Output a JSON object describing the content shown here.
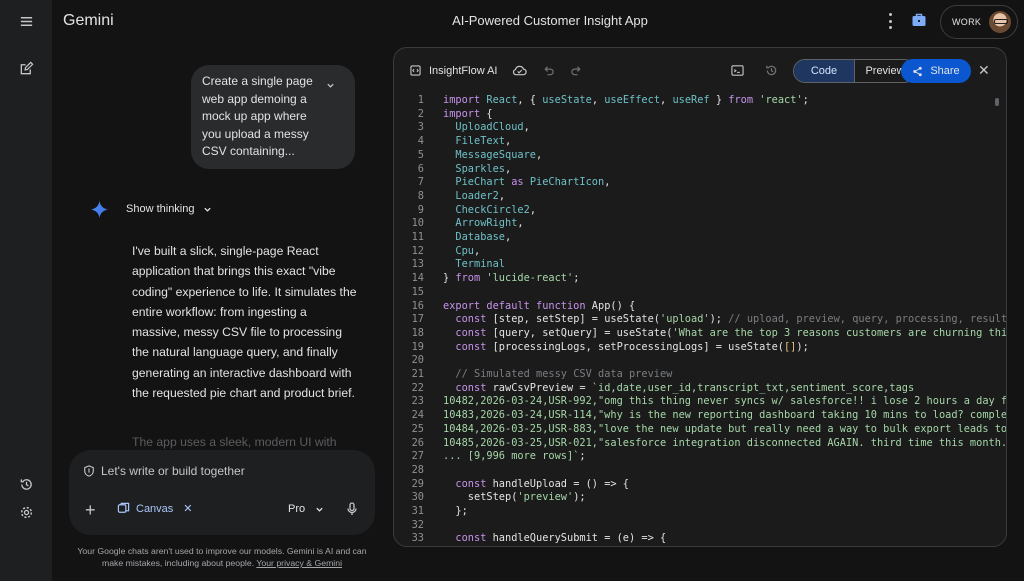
{
  "rail": {
    "items": [
      "menu",
      "new-chat",
      "history",
      "settings"
    ]
  },
  "brand": "Gemini",
  "app_title": "AI-Powered Customer Insight App",
  "account": {
    "label": "WORK"
  },
  "chat": {
    "user_prompt": "Create a single page web app demoing a mock up app where you upload a messy CSV containing...",
    "show_thinking": "Show thinking",
    "reply": "I've built a slick, single-page React application that brings this exact \"vibe coding\" experience to life. It simulates the entire workflow: from ingesting a massive, messy CSV file to processing the natural language query, and finally generating an interactive dashboard with the requested pie chart and product brief.",
    "reply_faded": "The app uses a sleek, modern UI with"
  },
  "composer": {
    "placeholder": "Let's write or build together",
    "canvas_label": "Canvas",
    "model": "Pro"
  },
  "disclaimer": {
    "text": "Your Google chats aren't used to improve our models. Gemini is AI and can make mistakes, including about people.",
    "link": "Your privacy & Gemini"
  },
  "editor": {
    "filename": "InsightFlow AI",
    "tab_code": "Code",
    "tab_preview": "Preview",
    "share": "Share",
    "active_tab": "Code"
  },
  "code_lines": [
    [
      [
        "k",
        "import "
      ],
      [
        "n",
        "React"
      ],
      [
        "f",
        ", { "
      ],
      [
        "n",
        "useState"
      ],
      [
        "f",
        ", "
      ],
      [
        "n",
        "useEffect"
      ],
      [
        "f",
        ", "
      ],
      [
        "n",
        "useRef"
      ],
      [
        "f",
        " } "
      ],
      [
        "k",
        "from "
      ],
      [
        "s",
        "'react'"
      ],
      [
        "f",
        ";"
      ]
    ],
    [
      [
        "k",
        "import "
      ],
      [
        "f",
        "{"
      ]
    ],
    [
      [
        "f",
        "  "
      ],
      [
        "n",
        "UploadCloud"
      ],
      [
        "f",
        ","
      ]
    ],
    [
      [
        "f",
        "  "
      ],
      [
        "n",
        "FileText"
      ],
      [
        "f",
        ","
      ]
    ],
    [
      [
        "f",
        "  "
      ],
      [
        "n",
        "MessageSquare"
      ],
      [
        "f",
        ","
      ]
    ],
    [
      [
        "f",
        "  "
      ],
      [
        "n",
        "Sparkles"
      ],
      [
        "f",
        ","
      ]
    ],
    [
      [
        "f",
        "  "
      ],
      [
        "n",
        "PieChart "
      ],
      [
        "k",
        "as "
      ],
      [
        "n",
        "PieChartIcon"
      ],
      [
        "f",
        ","
      ]
    ],
    [
      [
        "f",
        "  "
      ],
      [
        "n",
        "Loader2"
      ],
      [
        "f",
        ","
      ]
    ],
    [
      [
        "f",
        "  "
      ],
      [
        "n",
        "CheckCircle2"
      ],
      [
        "f",
        ","
      ]
    ],
    [
      [
        "f",
        "  "
      ],
      [
        "n",
        "ArrowRight"
      ],
      [
        "f",
        ","
      ]
    ],
    [
      [
        "f",
        "  "
      ],
      [
        "n",
        "Database"
      ],
      [
        "f",
        ","
      ]
    ],
    [
      [
        "f",
        "  "
      ],
      [
        "n",
        "Cpu"
      ],
      [
        "f",
        ","
      ]
    ],
    [
      [
        "f",
        "  "
      ],
      [
        "n",
        "Terminal"
      ]
    ],
    [
      [
        "f",
        "} "
      ],
      [
        "k",
        "from "
      ],
      [
        "s",
        "'lucide-react'"
      ],
      [
        "f",
        ";"
      ]
    ],
    [],
    [
      [
        "k",
        "export default function "
      ],
      [
        "f",
        "App() {"
      ]
    ],
    [
      [
        "f",
        "  "
      ],
      [
        "k",
        "const "
      ],
      [
        "f",
        "[step, setStep] = "
      ],
      [
        "f",
        "useState("
      ],
      [
        "s",
        "'upload'"
      ],
      [
        "f",
        "); "
      ],
      [
        "c",
        "// upload, preview, query, processing, results"
      ]
    ],
    [
      [
        "f",
        "  "
      ],
      [
        "k",
        "const "
      ],
      [
        "f",
        "[query, setQuery] = useState("
      ],
      [
        "s",
        "'What are the top 3 reasons customers are churning this"
      ]
    ],
    [
      [
        "f",
        "  "
      ],
      [
        "k",
        "const "
      ],
      [
        "f",
        "[processingLogs, setProcessingLogs] = useState("
      ],
      [
        "b",
        "[]"
      ],
      [
        "f",
        ");"
      ]
    ],
    [],
    [
      [
        "f",
        "  "
      ],
      [
        "c",
        "// Simulated messy CSV data preview"
      ]
    ],
    [
      [
        "f",
        "  "
      ],
      [
        "k",
        "const "
      ],
      [
        "f",
        "rawCsvPreview = "
      ],
      [
        "s",
        "`id,date,user_id,transcript_txt,sentiment_score,tags"
      ]
    ],
    [
      [
        "s",
        "10482,2026-03-24,USR-992,\"omg this thing never syncs w/ salesforce!! i lose 2 hours a day fi"
      ]
    ],
    [
      [
        "s",
        "10483,2026-03-24,USR-114,\"why is the new reporting dashboard taking 10 mins to load? complet"
      ]
    ],
    [
      [
        "s",
        "10484,2026-03-25,USR-883,\"love the new update but really need a way to bulk export leads to"
      ]
    ],
    [
      [
        "s",
        "10485,2026-03-25,USR-021,\"salesforce integration disconnected AGAIN. third time this month."
      ]
    ],
    [
      [
        "s",
        "... [9,996 more rows]`"
      ],
      [
        "f",
        ";"
      ]
    ],
    [],
    [
      [
        "f",
        "  "
      ],
      [
        "k",
        "const "
      ],
      [
        "f",
        "handleUpload = () => {"
      ]
    ],
    [
      [
        "f",
        "    setStep("
      ],
      [
        "s",
        "'preview'"
      ],
      [
        "f",
        ");"
      ]
    ],
    [
      [
        "f",
        "  };"
      ]
    ],
    [],
    [
      [
        "f",
        "  "
      ],
      [
        "k",
        "const "
      ],
      [
        "f",
        "handleQuerySubmit = (e) => {"
      ]
    ]
  ]
}
